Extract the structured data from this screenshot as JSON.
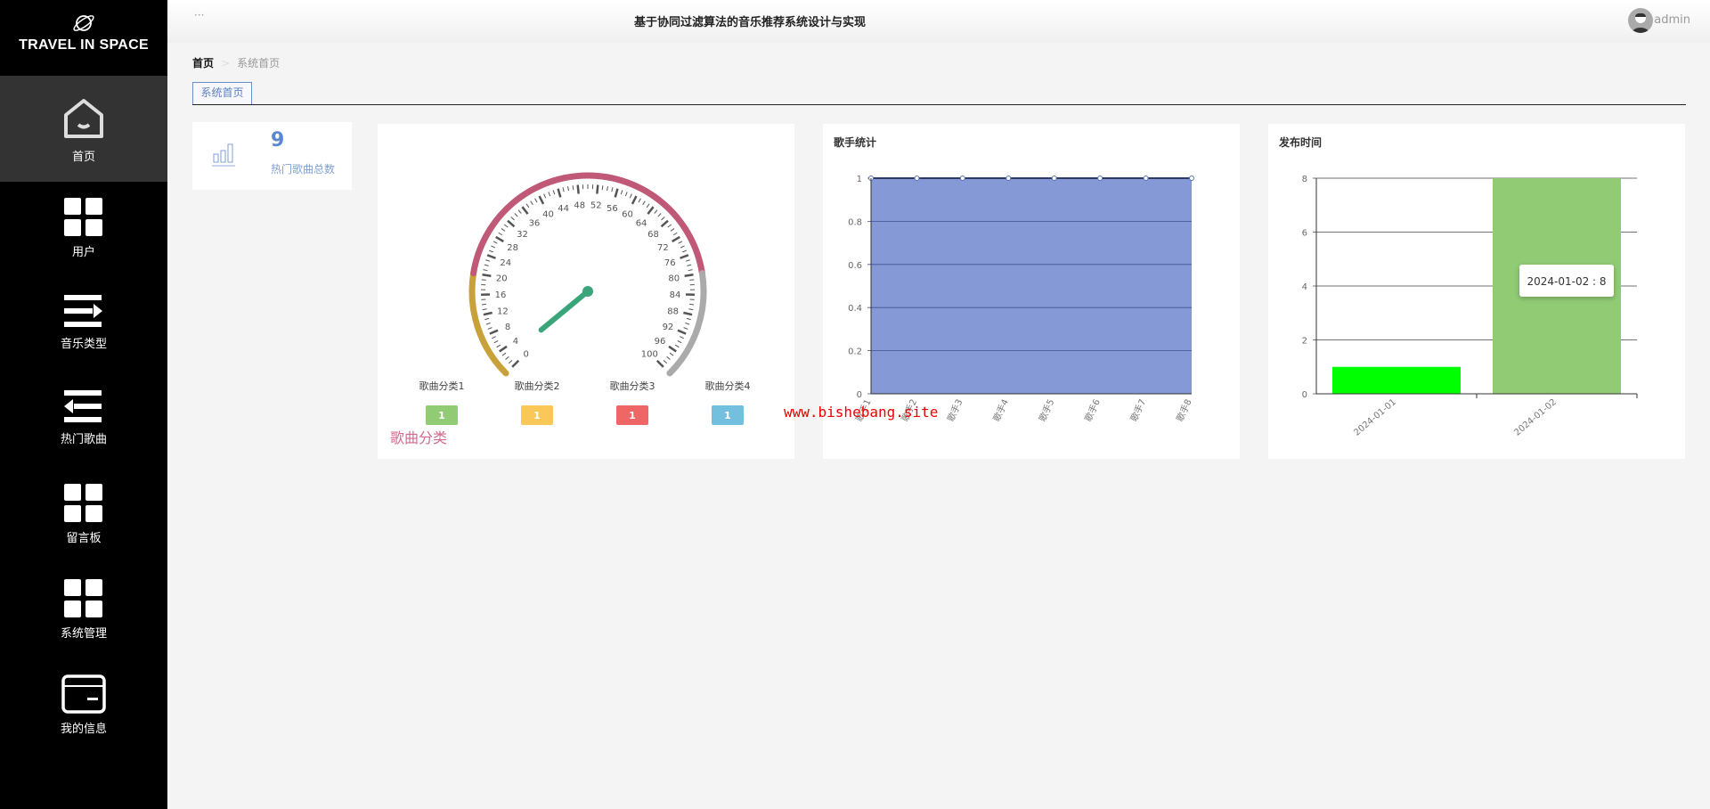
{
  "app": {
    "logo_text": "TRAVEL IN SPACE",
    "title": "基于协同过滤算法的音乐推荐系统设计与实现",
    "user": "admin",
    "menu_dots": "···"
  },
  "sidebar": {
    "items": [
      {
        "label": "首页",
        "icon": "home-icon",
        "active": true
      },
      {
        "label": "用户",
        "icon": "grid-icon"
      },
      {
        "label": "音乐类型",
        "icon": "list-indent-icon"
      },
      {
        "label": "热门歌曲",
        "icon": "list-outdent-icon"
      },
      {
        "label": "留言板",
        "icon": "grid-icon"
      },
      {
        "label": "系统管理",
        "icon": "grid-icon"
      },
      {
        "label": "我的信息",
        "icon": "card-icon"
      }
    ]
  },
  "breadcrumb": {
    "root": "首页",
    "current": "系统首页"
  },
  "tabs": [
    {
      "label": "系统首页"
    }
  ],
  "stat": {
    "value": "9",
    "label": "热门歌曲总数",
    "icon": "bar-chart-icon"
  },
  "watermark": "www.bishebang.site",
  "chart_data": [
    {
      "type": "gauge",
      "title": "歌曲分类",
      "min": 0,
      "max": 100,
      "value": 2,
      "ticks": [
        0,
        4,
        8,
        12,
        16,
        20,
        24,
        28,
        32,
        36,
        40,
        44,
        48,
        52,
        56,
        60,
        64,
        68,
        72,
        76,
        80,
        84,
        88,
        92,
        96,
        100
      ],
      "bands": [
        {
          "to": 0.2,
          "color": "#c9a13a"
        },
        {
          "to": 0.8,
          "color": "#c05878"
        },
        {
          "to": 1,
          "color": "#aaaaaa"
        }
      ],
      "pointer_color": "#3aa57a",
      "legend": [
        {
          "name": "歌曲分类1",
          "value": "1",
          "color": "#91cc75"
        },
        {
          "name": "歌曲分类2",
          "value": "1",
          "color": "#fac858"
        },
        {
          "name": "歌曲分类3",
          "value": "1",
          "color": "#ee6666"
        },
        {
          "name": "歌曲分类4",
          "value": "1",
          "color": "#73c0de"
        }
      ]
    },
    {
      "type": "area",
      "title": "歌手统计",
      "categories": [
        "歌手1",
        "歌手2",
        "歌手3",
        "歌手4",
        "歌手5",
        "歌手6",
        "歌手7",
        "歌手8"
      ],
      "values": [
        1,
        1,
        1,
        1,
        1,
        1,
        1,
        1
      ],
      "ylim": [
        0,
        1
      ],
      "yticks": [
        "0",
        "0.2",
        "0.4",
        "0.6",
        "0.8",
        "1"
      ],
      "color": "#8599d6",
      "grid": true
    },
    {
      "type": "bar",
      "title": "发布时间",
      "categories": [
        "2024-01-01",
        "2024-01-02"
      ],
      "values": [
        1,
        8
      ],
      "ylim": [
        0,
        8
      ],
      "yticks": [
        "0",
        "2",
        "4",
        "6",
        "8"
      ],
      "colors": [
        "#00ff00",
        "#91cc75"
      ],
      "grid": true,
      "tooltip": "2024-01-02 : 8"
    }
  ]
}
